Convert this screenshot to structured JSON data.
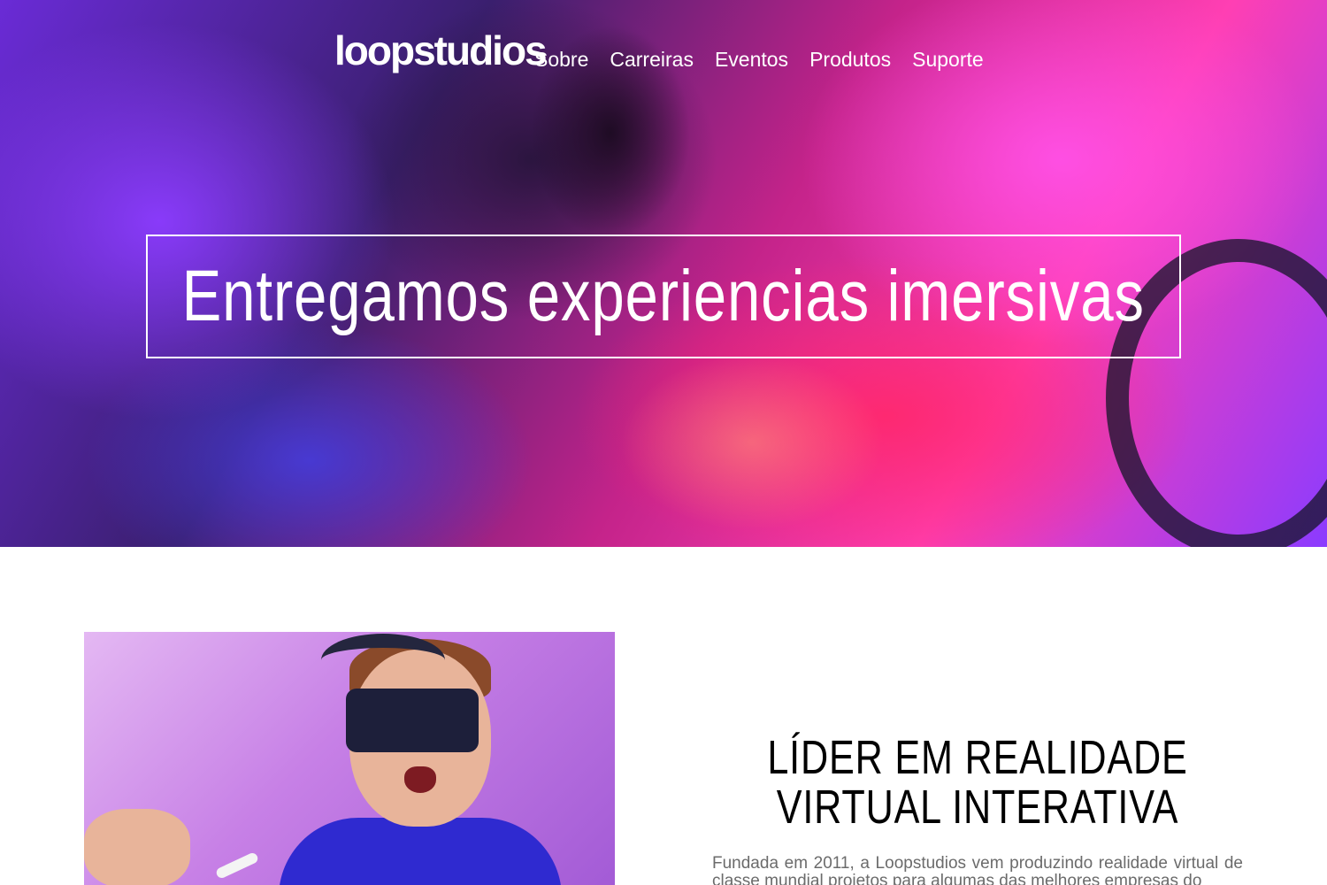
{
  "header": {
    "logo": "loopstudios",
    "nav": [
      {
        "label": "Sobre"
      },
      {
        "label": "Carreiras"
      },
      {
        "label": "Eventos"
      },
      {
        "label": "Produtos"
      },
      {
        "label": "Suporte"
      }
    ]
  },
  "hero": {
    "title": "Entregamos experiencias imersivas"
  },
  "about": {
    "title": "LÍDER EM REALIDADE VIRTUAL INTERATIVA",
    "text": "Fundada em 2011, a Loopstudios vem produzindo realidade virtual de classe mundial projetos para algumas das melhores empresas do"
  },
  "colors": {
    "accent_pink": "#ff3fb3",
    "accent_purple": "#8b3bff",
    "text_dark": "#000000",
    "text_muted": "#6b6b6b"
  }
}
